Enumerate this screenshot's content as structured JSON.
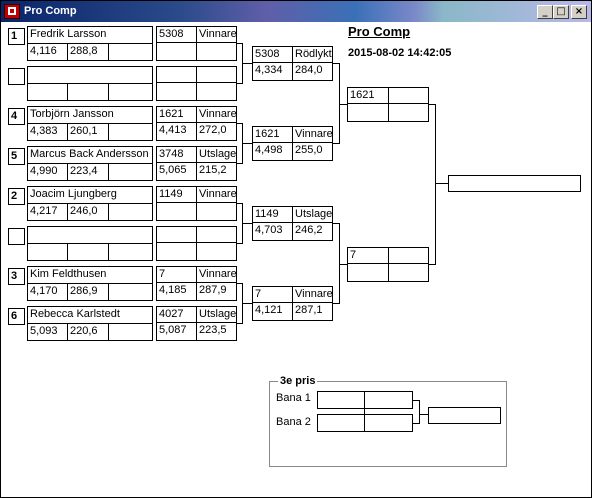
{
  "window": {
    "title": "Pro Comp",
    "buttons": {
      "minimize": "_",
      "maximize": "□",
      "close": "×"
    }
  },
  "header": {
    "title": "Pro Comp",
    "datetime": "2015-08-02 14:42:05"
  },
  "round1": [
    {
      "seed": "1",
      "name": "Fredrik Larsson",
      "rt": "4,116",
      "speed": "288,8",
      "time": "5308",
      "result": "Vinnare",
      "et": "",
      "mph": ""
    },
    {
      "seed": "",
      "name": "",
      "rt": "",
      "speed": "",
      "time": "",
      "result": "",
      "et": "",
      "mph": ""
    },
    {
      "seed": "4",
      "name": "Torbjörn Jansson",
      "rt": "4,383",
      "speed": "260,1",
      "time": "1621",
      "result": "Vinnare",
      "et": "4,413",
      "mph": "272,0"
    },
    {
      "seed": "5",
      "name": "Marcus Back Andersson",
      "rt": "4,990",
      "speed": "223,4",
      "time": "3748",
      "result": "Utslagen",
      "et": "5,065",
      "mph": "215,2"
    },
    {
      "seed": "2",
      "name": "Joacim Ljungberg",
      "rt": "4,217",
      "speed": "246,0",
      "time": "1149",
      "result": "Vinnare",
      "et": "",
      "mph": ""
    },
    {
      "seed": "",
      "name": "",
      "rt": "",
      "speed": "",
      "time": "",
      "result": "",
      "et": "",
      "mph": ""
    },
    {
      "seed": "3",
      "name": "Kim Feldthusen",
      "rt": "4,170",
      "speed": "286,9",
      "time": "7",
      "result": "Vinnare",
      "et": "4,185",
      "mph": "287,9"
    },
    {
      "seed": "6",
      "name": "Rebecca Karlstedt",
      "rt": "5,093",
      "speed": "220,6",
      "time": "4027",
      "result": "Utslagen",
      "et": "5,087",
      "mph": "223,5"
    }
  ],
  "round2": [
    {
      "time": "5308",
      "result": "Rödlykta",
      "et": "4,334",
      "mph": "284,0"
    },
    {
      "time": "1621",
      "result": "Vinnare",
      "et": "4,498",
      "mph": "255,0"
    },
    {
      "time": "1149",
      "result": "Utslagen",
      "et": "4,703",
      "mph": "246,2"
    },
    {
      "time": "7",
      "result": "Vinnare",
      "et": "4,121",
      "mph": "287,1"
    }
  ],
  "round3": [
    {
      "time": "1621",
      "result": "",
      "et": "",
      "mph": ""
    },
    {
      "time": "7",
      "result": "",
      "et": "",
      "mph": ""
    }
  ],
  "final": {
    "winner": ""
  },
  "third_place": {
    "legend": "3e pris",
    "lane1_label": "Bana 1",
    "lane2_label": "Bana 2",
    "lane1": "",
    "lane2": "",
    "winner": ""
  }
}
